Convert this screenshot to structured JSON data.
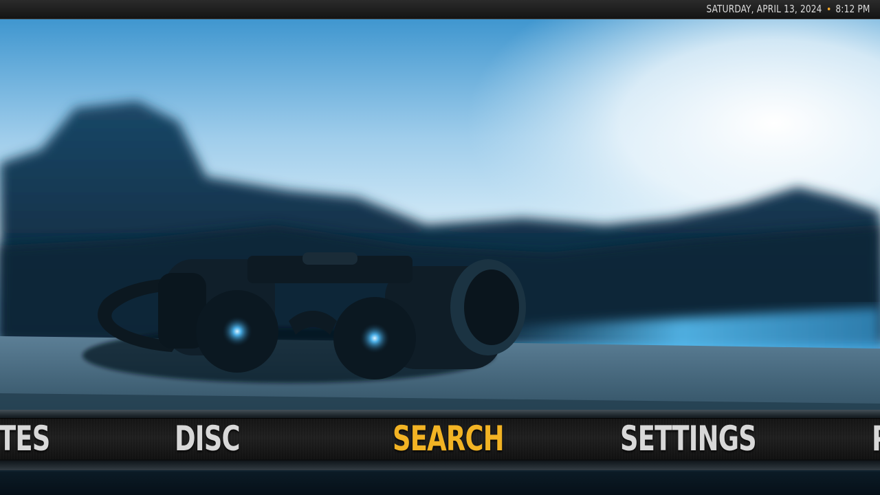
{
  "topbar": {
    "date": "SATURDAY, APRIL 13, 2024",
    "separator_color": "#f2a72a",
    "time": "8:12 PM"
  },
  "menu": {
    "items": [
      {
        "label": "TES",
        "active": false
      },
      {
        "label": "DISC",
        "active": false
      },
      {
        "label": "SEARCH",
        "active": true
      },
      {
        "label": "SETTINGS",
        "active": false
      },
      {
        "label": "P",
        "active": false
      }
    ],
    "active_color": "#f2b324",
    "inactive_color": "#d8d8d8"
  },
  "colors": {
    "sky_light": "#e9f5fc",
    "sky_blue": "#4aa3d8",
    "mountain": "#0e2a3e",
    "ledge": "#34566b"
  }
}
